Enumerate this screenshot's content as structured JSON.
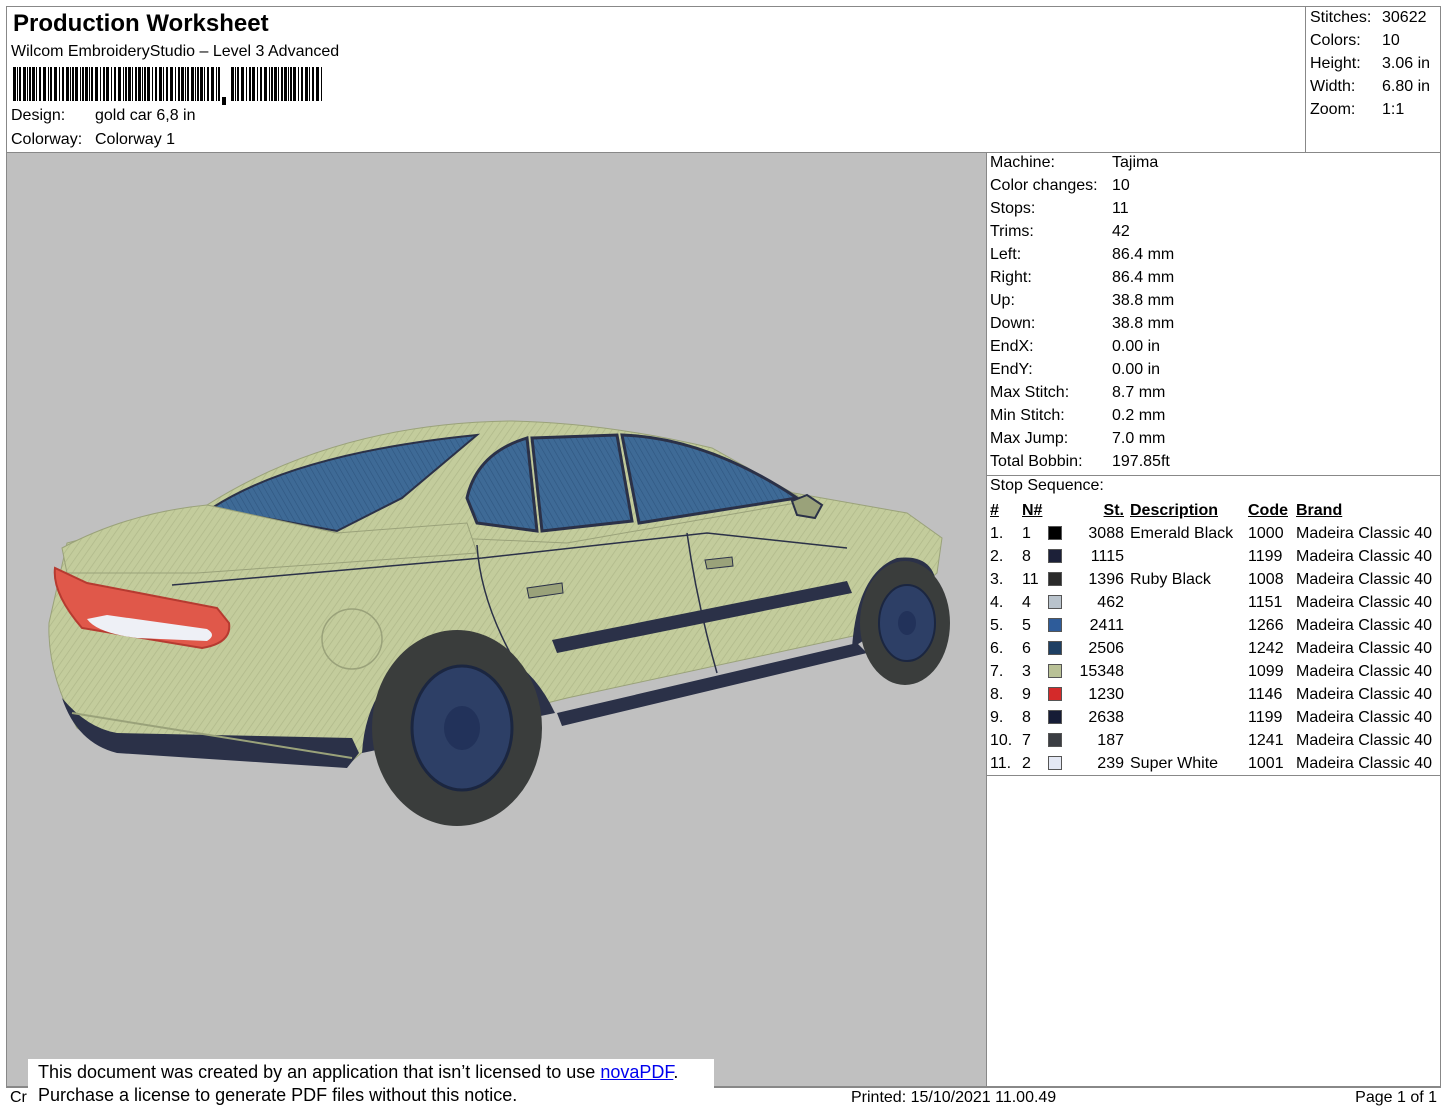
{
  "header": {
    "title": "Production Worksheet",
    "subtitle": "Wilcom EmbroideryStudio – Level 3 Advanced",
    "design_label": "Design:",
    "design_value": "gold car 6,8 in",
    "colorway_label": "Colorway:",
    "colorway_value": "Colorway 1"
  },
  "stats": [
    {
      "label": "Stitches:",
      "value": "30622"
    },
    {
      "label": "Colors:",
      "value": "10"
    },
    {
      "label": "Height:",
      "value": "3.06 in"
    },
    {
      "label": "Width:",
      "value": "6.80 in"
    },
    {
      "label": "Zoom:",
      "value": "1:1"
    }
  ],
  "machine_info": [
    {
      "label": "Machine:",
      "value": "Tajima"
    },
    {
      "label": "Color changes:",
      "value": "10"
    },
    {
      "label": "Stops:",
      "value": "11"
    },
    {
      "label": "Trims:",
      "value": "42"
    },
    {
      "label": "Left:",
      "value": "86.4 mm"
    },
    {
      "label": "Right:",
      "value": "86.4 mm"
    },
    {
      "label": "Up:",
      "value": "38.8 mm"
    },
    {
      "label": "Down:",
      "value": "38.8 mm"
    },
    {
      "label": "EndX:",
      "value": "0.00 in"
    },
    {
      "label": "EndY:",
      "value": "0.00 in"
    },
    {
      "label": "Max Stitch:",
      "value": "8.7 mm"
    },
    {
      "label": "Min Stitch:",
      "value": "0.2 mm"
    },
    {
      "label": "Max Jump:",
      "value": "7.0 mm"
    },
    {
      "label": "Total Bobbin:",
      "value": "197.85ft"
    }
  ],
  "stop_sequence": {
    "label": "Stop Sequence:",
    "columns": [
      "#",
      "N#",
      "St.",
      "Description",
      "Code",
      "Brand"
    ],
    "rows": [
      {
        "idx": "1.",
        "n": "1",
        "color": "#000000",
        "st": "3088",
        "desc": "Emerald Black",
        "code": "1000",
        "brand": "Madeira Classic 40"
      },
      {
        "idx": "2.",
        "n": "8",
        "color": "#1c2038",
        "st": "1115",
        "desc": "",
        "code": "1199",
        "brand": "Madeira Classic 40"
      },
      {
        "idx": "3.",
        "n": "11",
        "color": "#2a2a2a",
        "st": "1396",
        "desc": "Ruby Black",
        "code": "1008",
        "brand": "Madeira Classic 40"
      },
      {
        "idx": "4.",
        "n": "4",
        "color": "#b9c3cc",
        "st": "462",
        "desc": "",
        "code": "1151",
        "brand": "Madeira Classic 40"
      },
      {
        "idx": "5.",
        "n": "5",
        "color": "#2e5c9a",
        "st": "2411",
        "desc": "",
        "code": "1266",
        "brand": "Madeira Classic 40"
      },
      {
        "idx": "6.",
        "n": "6",
        "color": "#1e3f63",
        "st": "2506",
        "desc": "",
        "code": "1242",
        "brand": "Madeira Classic 40"
      },
      {
        "idx": "7.",
        "n": "3",
        "color": "#b9c196",
        "st": "15348",
        "desc": "",
        "code": "1099",
        "brand": "Madeira Classic 40"
      },
      {
        "idx": "8.",
        "n": "9",
        "color": "#d42a2a",
        "st": "1230",
        "desc": "",
        "code": "1146",
        "brand": "Madeira Classic 40"
      },
      {
        "idx": "9.",
        "n": "8",
        "color": "#161c36",
        "st": "2638",
        "desc": "",
        "code": "1199",
        "brand": "Madeira Classic 40"
      },
      {
        "idx": "10.",
        "n": "7",
        "color": "#3a3d42",
        "st": "187",
        "desc": "",
        "code": "1241",
        "brand": "Madeira Classic 40"
      },
      {
        "idx": "11.",
        "n": "2",
        "color": "#e4e8f4",
        "st": "239",
        "desc": "Super White",
        "code": "1001",
        "brand": "Madeira Classic 40"
      }
    ]
  },
  "footer": {
    "left_fragment": "Cr",
    "printed": "Printed: 15/10/2021 11.00.49",
    "page": "Page 1 of 1"
  },
  "notice": {
    "line1_pre": "This document was created by an application that isn’t licensed to use ",
    "link": "novaPDF",
    "line1_post": ".",
    "line2": "Purchase a license to generate PDF files without this notice."
  },
  "colors": {
    "preview_bg": "#c0c0c0",
    "car_body": "#c3cc9c",
    "glass": "#3e6a96",
    "tail_light": "#e0584a"
  }
}
